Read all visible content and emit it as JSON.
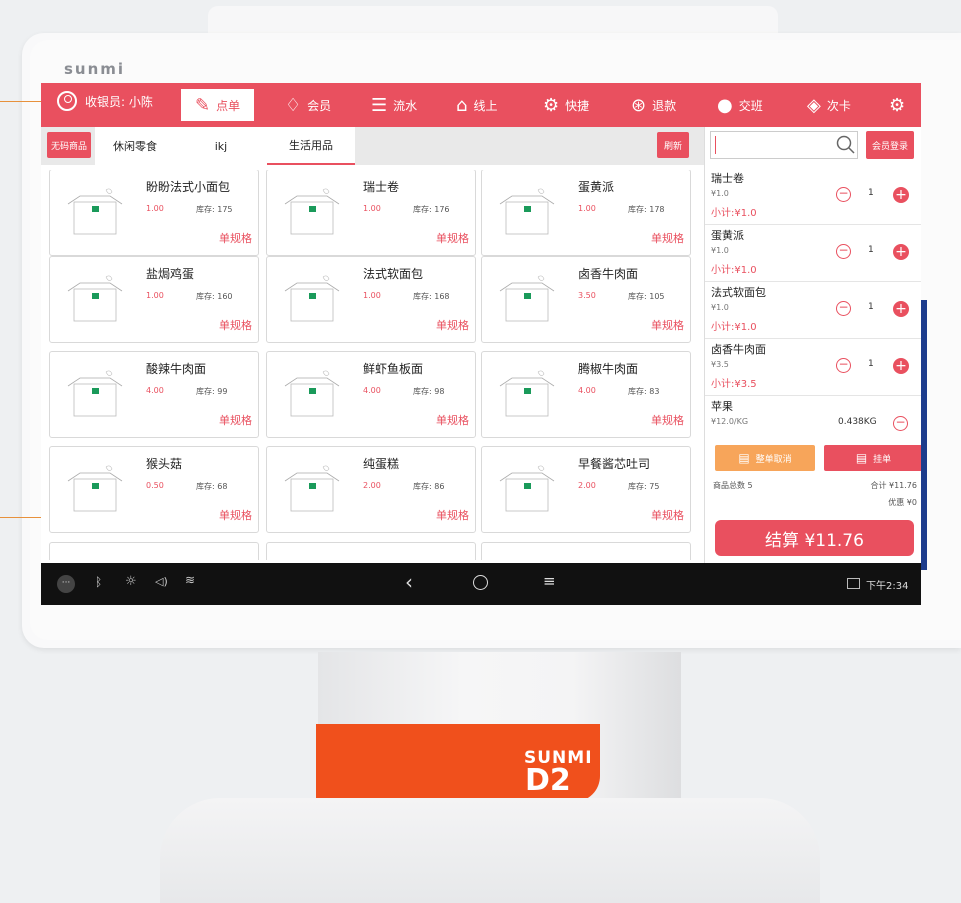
{
  "brand": {
    "top_logo": "sunmi",
    "stand_logo_top": "SUNMI",
    "stand_logo_bottom": "D2"
  },
  "topbar": {
    "cashier_label": "收银员: 小陈",
    "nav": [
      {
        "label": "点单",
        "icon": "pen-icon",
        "active": true
      },
      {
        "label": "会员",
        "icon": "diamond-icon"
      },
      {
        "label": "流水",
        "icon": "list-icon"
      },
      {
        "label": "线上",
        "icon": "store-icon"
      },
      {
        "label": "快捷",
        "icon": "gear-icon"
      },
      {
        "label": "退款",
        "icon": "refund-icon"
      },
      {
        "label": "交班",
        "icon": "shift-icon"
      },
      {
        "label": "次卡",
        "icon": "card-icon"
      }
    ],
    "settings_icon": "gear-icon"
  },
  "tabs": {
    "no_code": "无码商品",
    "items": [
      "休闲零食",
      "ikj",
      "生活用品"
    ],
    "active_index": 2,
    "refresh": "刷新"
  },
  "products": [
    {
      "name": "盼盼法式小面包",
      "price": "1.00",
      "stock": "库存: 175",
      "spec": "单规格"
    },
    {
      "name": "瑞士卷",
      "price": "1.00",
      "stock": "库存: 176",
      "spec": "单规格"
    },
    {
      "name": "蛋黄派",
      "price": "1.00",
      "stock": "库存: 178",
      "spec": "单规格"
    },
    {
      "name": "盐焗鸡蛋",
      "price": "1.00",
      "stock": "库存: 160",
      "spec": "单规格"
    },
    {
      "name": "法式软面包",
      "price": "1.00",
      "stock": "库存: 168",
      "spec": "单规格"
    },
    {
      "name": "卤香牛肉面",
      "price": "3.50",
      "stock": "库存: 105",
      "spec": "单规格"
    },
    {
      "name": "酸辣牛肉面",
      "price": "4.00",
      "stock": "库存: 99",
      "spec": "单规格"
    },
    {
      "name": "鲜虾鱼板面",
      "price": "4.00",
      "stock": "库存: 98",
      "spec": "单规格"
    },
    {
      "name": "腾椒牛肉面",
      "price": "4.00",
      "stock": "库存: 83",
      "spec": "单规格"
    },
    {
      "name": "猴头菇",
      "price": "0.50",
      "stock": "库存: 68",
      "spec": "单规格"
    },
    {
      "name": "纯蛋糕",
      "price": "2.00",
      "stock": "库存: 86",
      "spec": "单规格"
    },
    {
      "name": "早餐酱芯吐司",
      "price": "2.00",
      "stock": "库存: 75",
      "spec": "单规格"
    }
  ],
  "panel": {
    "member_login": "会员登录",
    "search_placeholder": "",
    "order": [
      {
        "name": "瑞士卷",
        "price": "¥1.0",
        "qty": "1",
        "subtotal": "小计:¥1.0"
      },
      {
        "name": "蛋黄派",
        "price": "¥1.0",
        "qty": "1",
        "subtotal": "小计:¥1.0"
      },
      {
        "name": "法式软面包",
        "price": "¥1.0",
        "qty": "1",
        "subtotal": "小计:¥1.0"
      },
      {
        "name": "卤香牛肉面",
        "price": "¥3.5",
        "qty": "1",
        "subtotal": "小计:¥3.5"
      },
      {
        "name": "苹果",
        "price": "¥12.0/KG",
        "qty": "0.438KG",
        "subtotal": ""
      }
    ],
    "cancel_all": "整单取消",
    "hold": "挂单",
    "total_count": "商品总数 5",
    "total": "合计 ¥11.76",
    "discount": "优惠 ¥0",
    "checkout": "结算 ¥11.76"
  },
  "system": {
    "time": "下午2:34"
  },
  "colors": {
    "accent": "#e9505f",
    "orange": "#f7a55a",
    "stand": "#f0501c"
  }
}
